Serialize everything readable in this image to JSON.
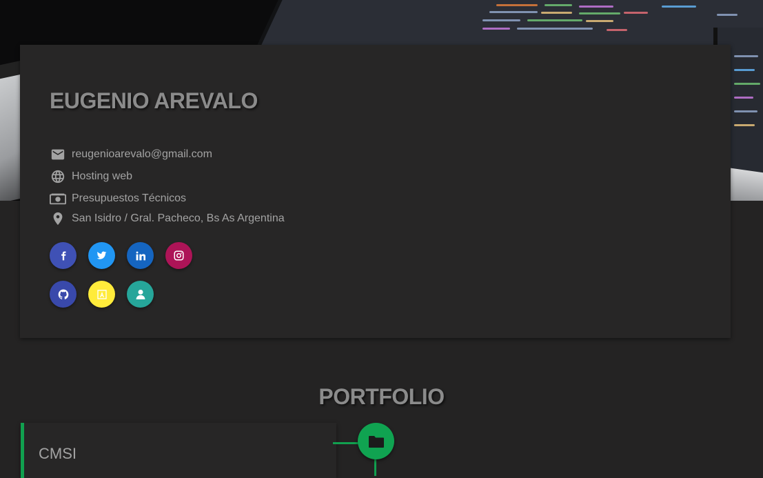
{
  "profile": {
    "name": "EUGENIO AREVALO",
    "email": "reugenioarevalo@gmail.com",
    "hosting": "Hosting web",
    "budget": "Presupuestos Técnicos",
    "location": "San Isidro / Gral. Pacheco, Bs As Argentina"
  },
  "social": [
    {
      "icon": "facebook-icon",
      "color": "#3f51b5"
    },
    {
      "icon": "twitter-icon",
      "color": "#2196f3"
    },
    {
      "icon": "linkedin-icon",
      "color": "#1565c0"
    },
    {
      "icon": "instagram-icon",
      "color": "#ad1457"
    },
    {
      "icon": "github-icon",
      "color": "#3949ab"
    },
    {
      "icon": "angular-icon",
      "color": "#ffeb3b"
    },
    {
      "icon": "user-icon",
      "color": "#26a69a"
    }
  ],
  "portfolio": {
    "title": "PORTFOLIO",
    "items": [
      {
        "title": "CMSI",
        "icon": "folder-icon",
        "accent": "#11a04f"
      }
    ]
  }
}
